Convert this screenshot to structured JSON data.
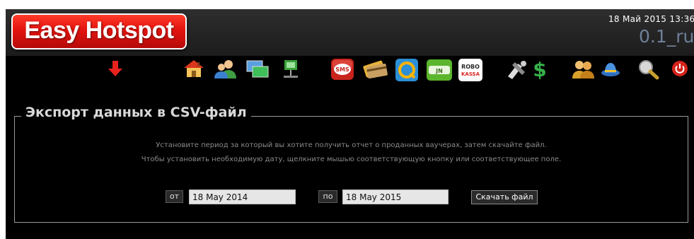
{
  "header": {
    "logo_text": "Easy Hotspot",
    "date": "18 Май 2015  13:36",
    "version": "0.1_ru"
  },
  "toolbar": {
    "icons": [
      "arrow-down-icon",
      "home-icon",
      "users-icon",
      "monitors-icon",
      "network-icon",
      "sms-icon",
      "cards-icon",
      "qiwi-icon",
      "payment-logo-icon",
      "robokassa-icon",
      "tools-icon",
      "money-icon",
      "admins-icon",
      "hat-icon",
      "search-icon",
      "power-icon"
    ],
    "sms_text": "SMS",
    "robo_text_1": "ROBO",
    "robo_text_2": "KASSA",
    "pay_text": "JN"
  },
  "panel": {
    "title": "Экспорт данных в CSV-файл",
    "info_line_1": "Установите период за который вы хотите получить отчет о проданных ваучерах, затем скачайте файл.",
    "info_line_2": "Чтобы установить необходимую дату, щелкните мышью соответствующую кнопку или соответствующее поле."
  },
  "form": {
    "from_label": "от",
    "from_value": "18 May 2014",
    "to_label": "по",
    "to_value": "18 May 2015",
    "download_label": "Скачать файл"
  },
  "colors": {
    "logo_red": "#e3140e",
    "version_text": "#6f7f9a",
    "background": "#000000"
  }
}
